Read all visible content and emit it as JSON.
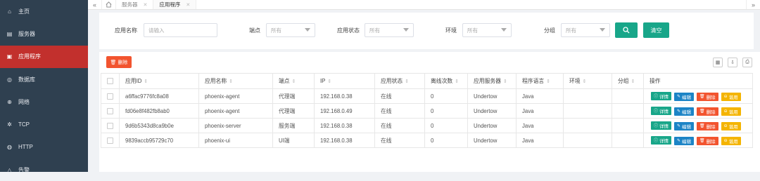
{
  "sidebar": {
    "items": [
      {
        "label": "主页",
        "icon": "home-icon",
        "active": false
      },
      {
        "label": "服务器",
        "icon": "server-icon",
        "active": false
      },
      {
        "label": "应用程序",
        "icon": "app-icon",
        "active": true
      },
      {
        "label": "数据库",
        "icon": "database-icon",
        "active": false
      },
      {
        "label": "网络",
        "icon": "network-icon",
        "active": false
      },
      {
        "label": "TCP",
        "icon": "tcp-icon",
        "active": false
      },
      {
        "label": "HTTP",
        "icon": "http-icon",
        "active": false
      },
      {
        "label": "告警",
        "icon": "bell-icon",
        "active": false
      }
    ]
  },
  "topbar": {
    "tabs": [
      {
        "label": "服务器"
      },
      {
        "label": "应用程序"
      }
    ]
  },
  "search": {
    "app_name_label": "应用名称",
    "app_name_placeholder": "请输入",
    "endpoint_label": "端点",
    "endpoint_value": "所有",
    "status_label": "应用状态",
    "status_value": "所有",
    "env_label": "环境",
    "env_value": "所有",
    "group_label": "分组",
    "group_value": "所有",
    "clear_label": "清空"
  },
  "toolbar": {
    "delete_label": "删除"
  },
  "table": {
    "headers": {
      "app_id": "应用ID",
      "app_name": "应用名称",
      "endpoint": "端点",
      "ip": "IP",
      "status": "应用状态",
      "offline_count": "离线次数",
      "app_server": "应用服务器",
      "language": "程序语言",
      "env": "环境",
      "group": "分组",
      "ops": "操作"
    },
    "rows": [
      {
        "app_id": "a6ffac9776fc8a08",
        "app_name": "phoenix-agent",
        "endpoint": "代理端",
        "ip": "192.168.0.38",
        "status": "在线",
        "offline_count": "0",
        "app_server": "Undertow",
        "language": "Java",
        "env": "",
        "group": ""
      },
      {
        "app_id": "fd06e8f482fb8ab0",
        "app_name": "phoenix-agent",
        "endpoint": "代理端",
        "ip": "192.168.0.49",
        "status": "在线",
        "offline_count": "0",
        "app_server": "Undertow",
        "language": "Java",
        "env": "",
        "group": ""
      },
      {
        "app_id": "9d6b5343d8ca9b0e",
        "app_name": "phoenix-server",
        "endpoint": "服务端",
        "ip": "192.168.0.38",
        "status": "在线",
        "offline_count": "0",
        "app_server": "Undertow",
        "language": "Java",
        "env": "",
        "group": ""
      },
      {
        "app_id": "9839accb95729c70",
        "app_name": "phoenix-ui",
        "endpoint": "UI端",
        "ip": "192.168.0.38",
        "status": "在线",
        "offline_count": "0",
        "app_server": "Undertow",
        "language": "Java",
        "env": "",
        "group": ""
      }
    ],
    "actions": {
      "detail": "详情",
      "edit": "编辑",
      "delete": "删除",
      "disable": "谐用"
    }
  },
  "colors": {
    "sidebar_bg": "#2f4050",
    "active_nav": "#c2302d",
    "primary": "#18a689",
    "edit": "#1c84c6",
    "danger": "#f2542f",
    "warning": "#f4b400"
  }
}
